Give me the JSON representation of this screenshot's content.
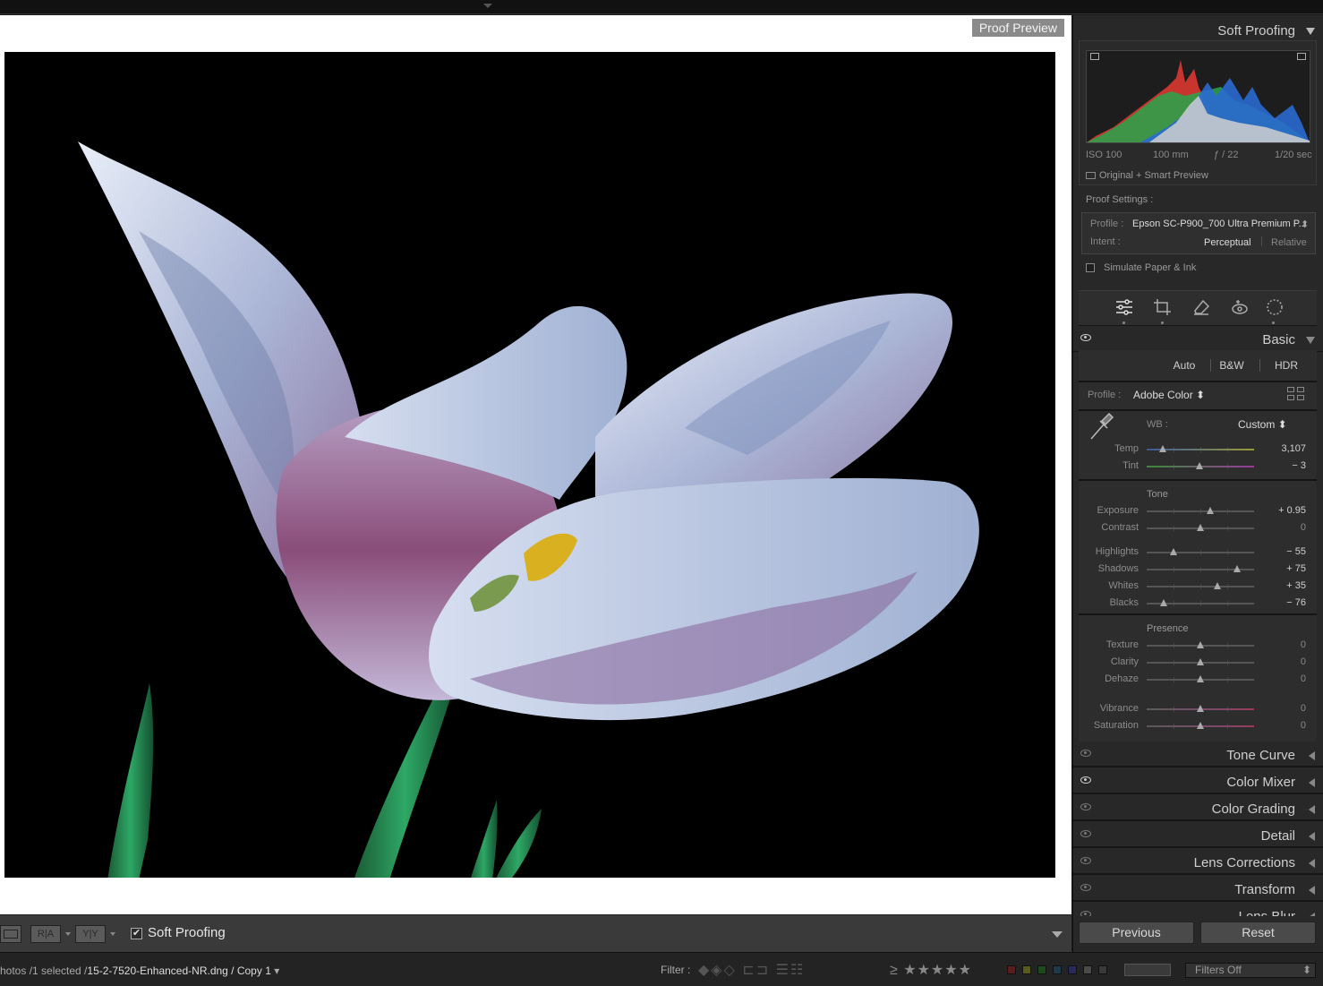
{
  "app": {
    "proof_label": "Proof Preview"
  },
  "toolbar": {
    "view_icon": "loupe-view-icon",
    "compare_ab": "R|A",
    "compare_yy": "Y|Y",
    "soft_proofing_label": "Soft Proofing",
    "soft_proofing_checked": true
  },
  "filmstrip": {
    "path_prefix": "hotos /1 selected /",
    "filename": "15-2-7520-Enhanced-NR.dng / Copy 1",
    "filter_label": "Filter :",
    "rating_op": "≥",
    "stars": "★★★★★",
    "filters_off": "Filters Off",
    "swatch_colors": [
      "#5a1c1c",
      "#5a5a1c",
      "#1c4a1c",
      "#1c3a4a",
      "#2a2a5a",
      "#4a4a4a",
      "#3a3a3a"
    ]
  },
  "panel": {
    "soft_proofing_title": "Soft Proofing",
    "exif": {
      "iso": "ISO 100",
      "focal": "100 mm",
      "aperture": "ƒ / 22",
      "shutter": "1/20 sec"
    },
    "preview_mode": "Original + Smart Preview",
    "proof_settings_label": "Proof Settings :",
    "profile_label": "Profile :",
    "profile_value": "Epson SC-P900_700 Ultra Premium P...",
    "intent_label": "Intent :",
    "intent_options": [
      "Perceptual",
      "Relative"
    ],
    "intent_selected": "Perceptual",
    "simulate_label": "Simulate Paper & Ink",
    "simulate_checked": false,
    "tools": [
      "edit-sliders-icon",
      "crop-icon",
      "healing-eraser-icon",
      "red-eye-icon",
      "masking-icon"
    ],
    "basic": {
      "title": "Basic",
      "buttons": [
        "Auto",
        "B&W",
        "HDR"
      ],
      "profile_label": "Profile :",
      "profile_value": "Adobe Color ⬍",
      "wb_label": "WB :",
      "wb_value": "Custom ⬍",
      "sliders_wb": [
        {
          "label": "Temp",
          "value": "3,107",
          "pos": 0.15
        },
        {
          "label": "Tint",
          "value": "− 3",
          "pos": 0.49
        }
      ],
      "tone_title": "Tone",
      "sliders_tone": [
        {
          "label": "Exposure",
          "value": "+ 0.95",
          "pos": 0.59
        },
        {
          "label": "Contrast",
          "value": "0",
          "pos": 0.5
        }
      ],
      "sliders_tone2": [
        {
          "label": "Highlights",
          "value": "− 55",
          "pos": 0.25
        },
        {
          "label": "Shadows",
          "value": "+ 75",
          "pos": 0.84
        },
        {
          "label": "Whites",
          "value": "+ 35",
          "pos": 0.66
        },
        {
          "label": "Blacks",
          "value": "− 76",
          "pos": 0.16
        }
      ],
      "presence_title": "Presence",
      "sliders_presence": [
        {
          "label": "Texture",
          "value": "0",
          "pos": 0.5
        },
        {
          "label": "Clarity",
          "value": "0",
          "pos": 0.5
        },
        {
          "label": "Dehaze",
          "value": "0",
          "pos": 0.5
        }
      ],
      "sliders_presence2": [
        {
          "label": "Vibrance",
          "value": "0",
          "pos": 0.5
        },
        {
          "label": "Saturation",
          "value": "0",
          "pos": 0.5
        }
      ]
    },
    "collapsed_panels": [
      "Tone Curve",
      "Color Mixer",
      "Color Grading",
      "Detail",
      "Lens Corrections",
      "Transform",
      "Lens Blur"
    ],
    "previous_label": "Previous",
    "reset_label": "Reset"
  }
}
